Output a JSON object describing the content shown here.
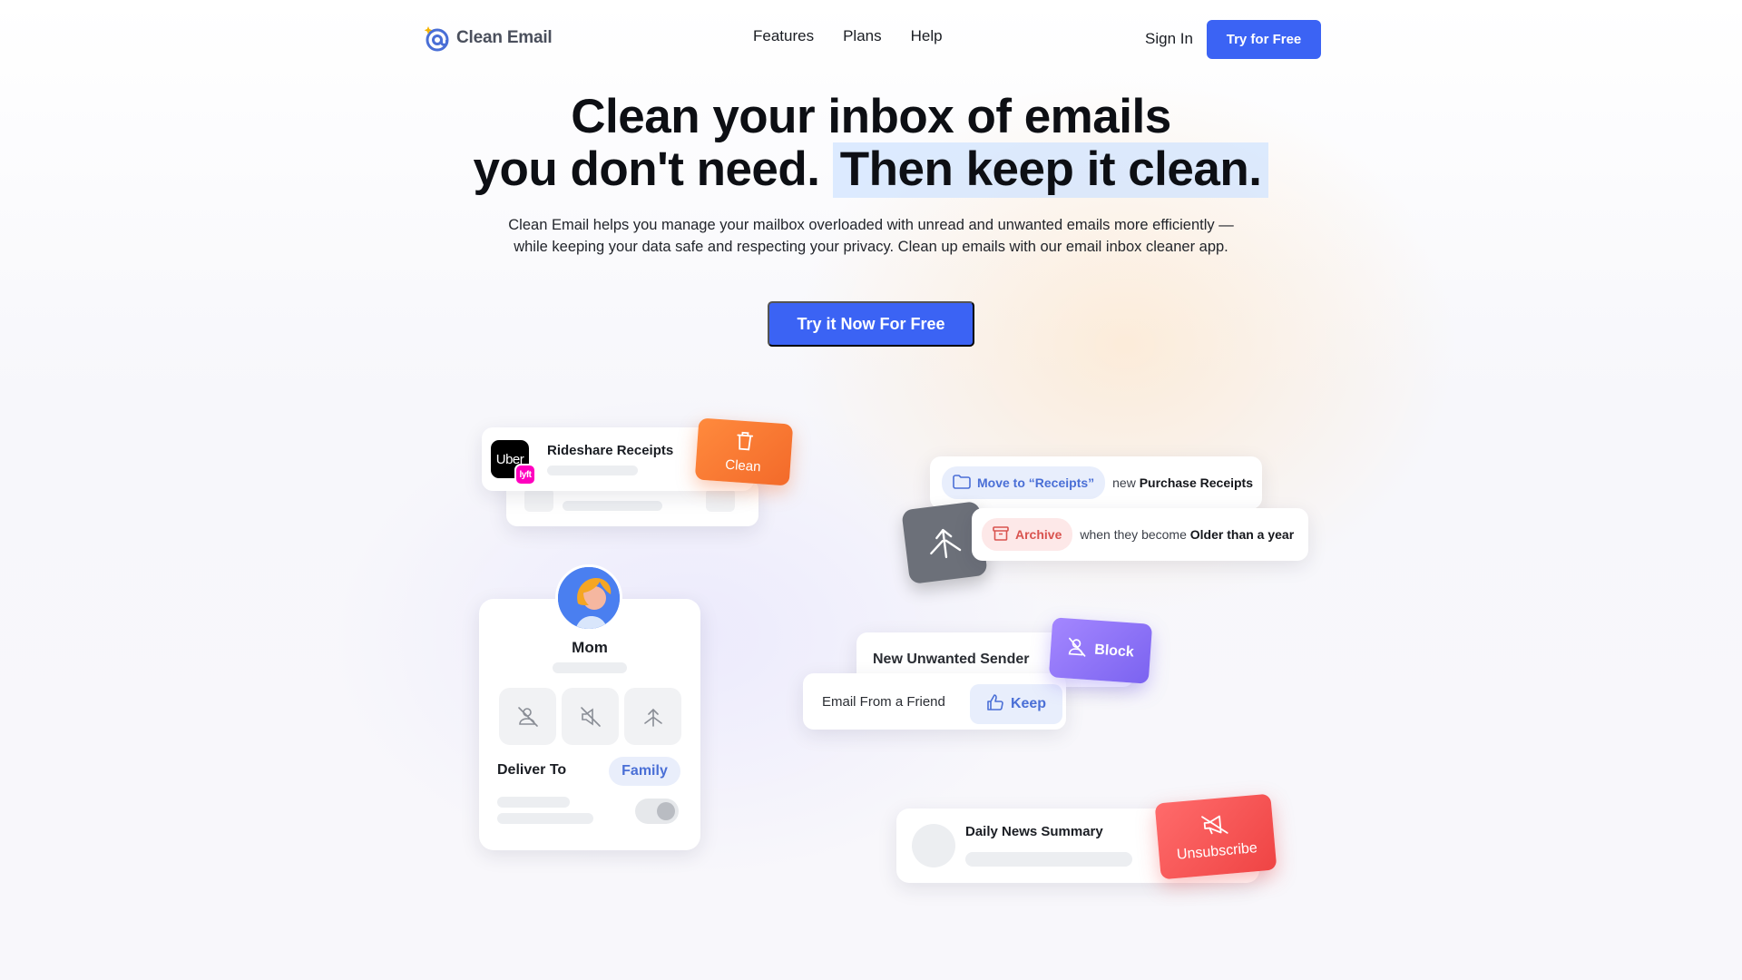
{
  "header": {
    "logo_text": "Clean Email",
    "nav": [
      "Features",
      "Plans",
      "Help"
    ],
    "sign_in": "Sign In",
    "try_free": "Try for Free"
  },
  "hero": {
    "headline_line1": "Clean your inbox of emails",
    "headline_line2a": "you don't need.",
    "headline_line2b": "Then keep it clean.",
    "subtext": "Clean Email helps you manage your mailbox overloaded with unread and unwanted emails more efficiently — while keeping your data safe and respecting your privacy. Clean up emails with our email inbox cleaner app.",
    "cta": "Try it Now For Free"
  },
  "rideshare": {
    "logo_text": "Uber",
    "badge_text": "lyft",
    "title": "Rideshare Receipts",
    "action": "Clean"
  },
  "rules": {
    "move_label": "Move to “Receipts”",
    "move_prefix": "new",
    "move_target": "Purchase Receipts",
    "archive_label": "Archive",
    "archive_prefix": "when they become",
    "archive_target": "Older than a year"
  },
  "mom": {
    "name": "Mom",
    "deliver_to": "Deliver To",
    "folder": "Family"
  },
  "senders": {
    "unwanted": "New Unwanted Sender",
    "block": "Block",
    "friend": "Email From a Friend",
    "keep": "Keep"
  },
  "news": {
    "title": "Daily News Summary",
    "action": "Unsubscribe"
  },
  "colors": {
    "primary": "#3b63f4",
    "clean": "#f36a2a",
    "block": "#7b63f0",
    "unsubscribe": "#ef4444",
    "highlight": "#cfe2ff"
  }
}
